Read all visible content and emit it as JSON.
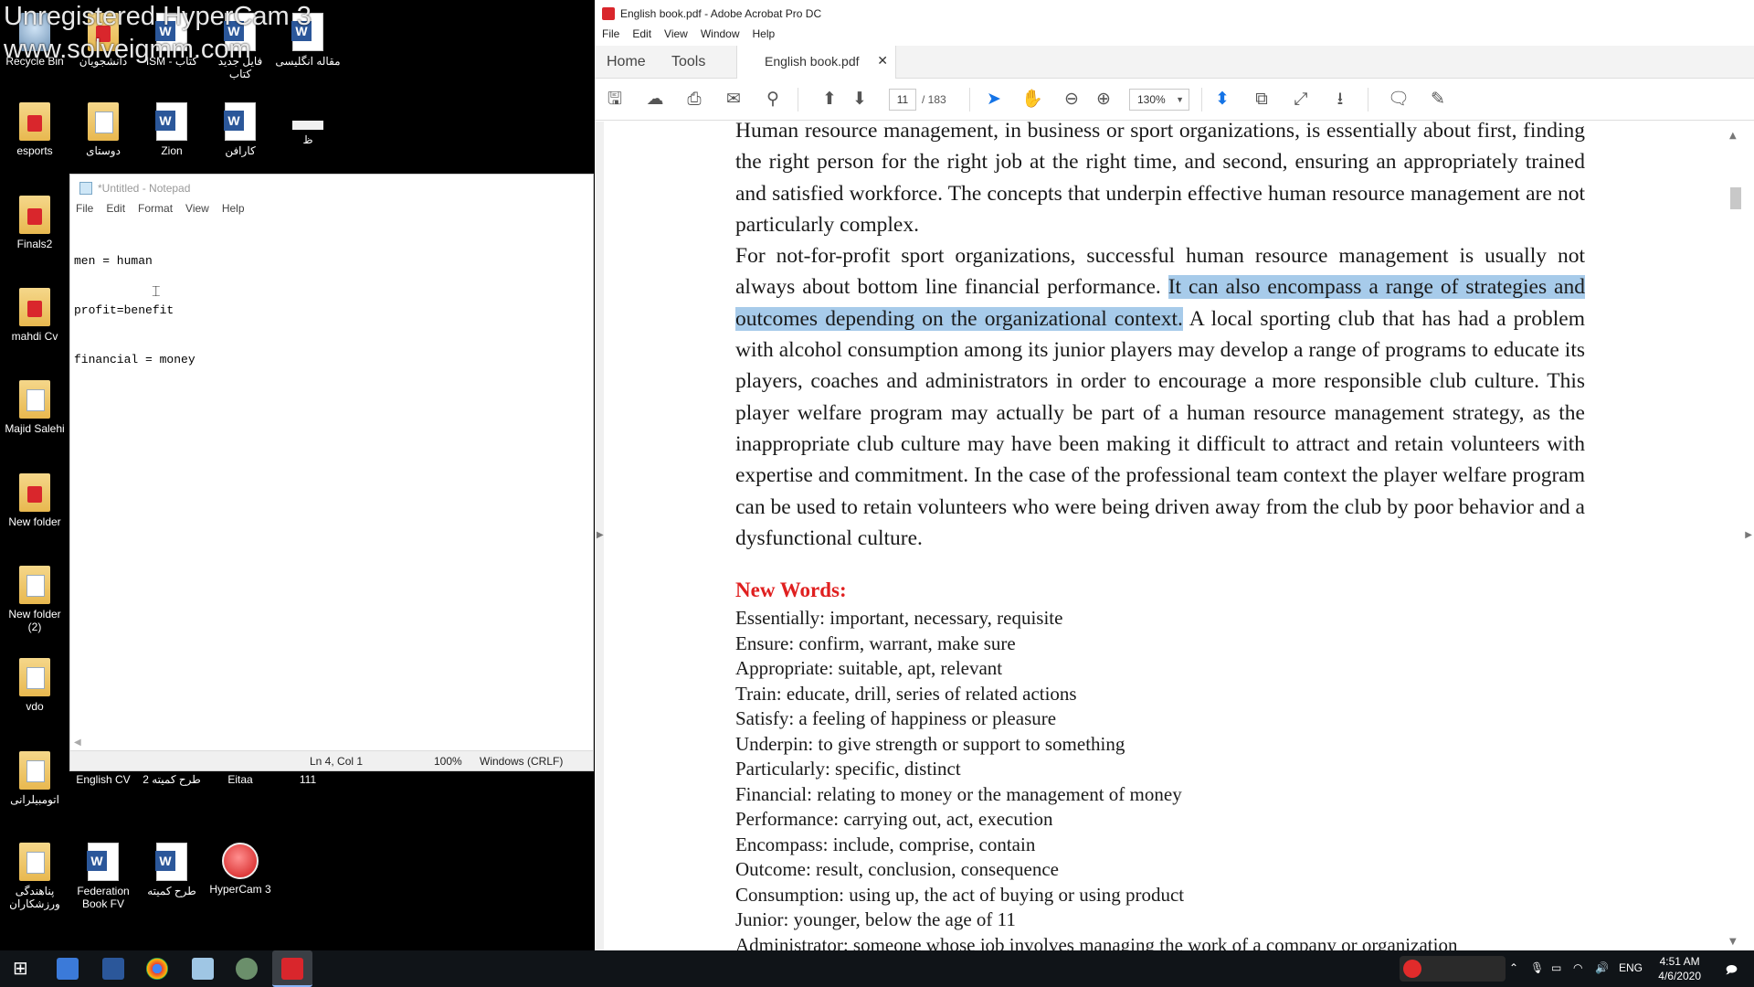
{
  "desktop": {
    "watermark_line1": "Unregistered HyperCam 3",
    "watermark_line2": "www.solveigmm.com",
    "icons": [
      {
        "label": "Recycle Bin"
      },
      {
        "label": "دانشجویان"
      },
      {
        "label": "ISM - کتاب"
      },
      {
        "label": "فایل جدید کتاب"
      },
      {
        "label": "مقاله انگلیسی"
      },
      {
        "label": "esports"
      },
      {
        "label": "دوستای"
      },
      {
        "label": "Zion"
      },
      {
        "label": "کارافن"
      },
      {
        "label": "ظ"
      },
      {
        "label": "Finals2"
      },
      {
        "label": "mahdi Cv"
      },
      {
        "label": "Majid Salehi"
      },
      {
        "label": "New folder"
      },
      {
        "label": "New folder (2)"
      },
      {
        "label": "vdo"
      },
      {
        "label": "اتومبیلرانی"
      },
      {
        "label": "English CV"
      },
      {
        "label": "طرح کمیته 2"
      },
      {
        "label": "Eitaa"
      },
      {
        "label": "111"
      },
      {
        "label": "پناهندگی ورزشکاران"
      },
      {
        "label": "Federation Book FV"
      },
      {
        "label": "طرح کمیته"
      },
      {
        "label": "HyperCam 3"
      }
    ]
  },
  "notepad": {
    "title": "*Untitled - Notepad",
    "menu": [
      "File",
      "Edit",
      "Format",
      "View",
      "Help"
    ],
    "lines": [
      "men = human",
      "profit=benefit",
      "financial = money"
    ],
    "status": {
      "position": "Ln 4, Col 1",
      "zoom": "100%",
      "line_ending": "Windows (CRLF)"
    }
  },
  "acrobat": {
    "title": "English book.pdf - Adobe Acrobat Pro DC",
    "menu": [
      "File",
      "Edit",
      "View",
      "Window",
      "Help"
    ],
    "tabs": {
      "home": "Home",
      "tools": "Tools",
      "document": "English book.pdf"
    },
    "toolbar": {
      "current_page": "11",
      "total_pages": "/ 183",
      "zoom": "130%"
    },
    "content": {
      "paragraph1": "Human resource management, in business or sport organizations, is essentially about first, finding the right person for the right job at the right time, and second, ensuring an appropriately trained and satisfied workforce. The concepts that underpin effective human resource management are not particularly complex.",
      "paragraph2_before": "For not-for-profit sport organizations, successful human resource management is usually not always about bottom line financial performance. ",
      "paragraph2_highlight": "It can also encompass a range of strategies and outcomes depending on the organizational context.",
      "paragraph2_after": " A local sporting club that has had a problem with alcohol consumption among its junior players may develop a range of programs to educate its players, coaches and administrators in order to encourage a more responsible club culture. This player welfare program may actually be part of a human resource management strategy, as the inappropriate club culture may have been making it difficult to attract and retain volunteers with expertise and commitment. In the case of the professional team context the player welfare program can be used to retain volunteers who were being driven away from the club by poor behavior and a dysfunctional culture.",
      "new_words_title": "New Words:",
      "new_words": [
        "Essentially: important, necessary, requisite",
        "Ensure: confirm, warrant, make sure",
        "Appropriate: suitable, apt, relevant",
        "Train: educate, drill, series of related actions",
        "Satisfy: a feeling of happiness or pleasure",
        "Underpin: to give strength or support to something",
        "Particularly: specific, distinct",
        "Financial: relating to money or the management of money",
        "Performance: carrying out, act, execution",
        "Encompass: include, comprise, contain",
        "Outcome: result, conclusion, consequence",
        "Consumption: using up, the act of buying or using product",
        "Junior: younger, below the age of 11",
        "Administrator: someone whose job involves managing the work of a company or organization"
      ]
    }
  },
  "taskbar": {
    "language": "ENG",
    "time": "4:51 AM",
    "date": "4/6/2020"
  }
}
